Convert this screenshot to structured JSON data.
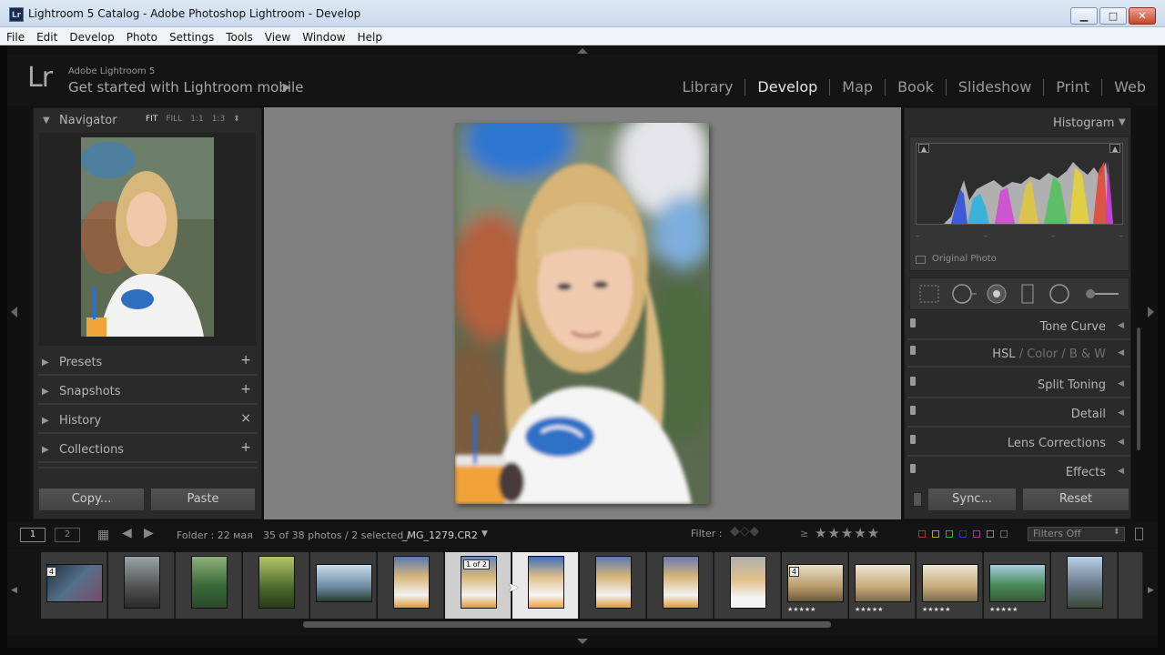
{
  "window": {
    "title": "Lightroom 5 Catalog - Adobe Photoshop Lightroom - Develop",
    "app_icon": "Lr",
    "controls": [
      "minimize-icon",
      "maximize-icon",
      "close-icon"
    ]
  },
  "menu": [
    "File",
    "Edit",
    "Develop",
    "Photo",
    "Settings",
    "Tools",
    "View",
    "Window",
    "Help"
  ],
  "identity": {
    "logo": "Lr",
    "product": "Adobe Lightroom 5",
    "mobile_prompt": "Get started with Lightroom mobile",
    "play_icon": "▶"
  },
  "modules": [
    "Library",
    "Develop",
    "Map",
    "Book",
    "Slideshow",
    "Print",
    "Web"
  ],
  "active_module": "Develop",
  "left": {
    "navigator": {
      "title": "Navigator",
      "zoom": [
        "FIT",
        "FILL",
        "1:1",
        "1:3"
      ],
      "zoom_active": "FIT"
    },
    "panels": [
      {
        "label": "Presets",
        "action": "+"
      },
      {
        "label": "Snapshots",
        "action": "+"
      },
      {
        "label": "History",
        "action": "×"
      },
      {
        "label": "Collections",
        "action": "+"
      }
    ],
    "copy_label": "Copy...",
    "paste_label": "Paste"
  },
  "right": {
    "histogram_title": "Histogram",
    "original_photo": "Original Photo",
    "tools": [
      "crop-overlay-icon",
      "spot-removal-icon",
      "red-eye-icon",
      "graduated-filter-icon",
      "radial-filter-icon",
      "adjustment-brush-icon"
    ],
    "panels": {
      "tone_curve": "Tone Curve",
      "hsl": "HSL",
      "color": "Color",
      "bw": "B & W",
      "split_toning": "Split Toning",
      "detail": "Detail",
      "lens": "Lens Corrections",
      "effects": "Effects"
    },
    "sync_label": "Sync...",
    "reset_label": "Reset"
  },
  "toolbar": {
    "view1": "1",
    "view2": "2",
    "folder": "Folder : 22 мая",
    "count": "35 of 38 photos / 2 selected /",
    "filename": "_MG_1279.CR2",
    "filter_label": "Filter :",
    "rating_op": "≥",
    "stars": "★★★★★",
    "filters_off": "Filters Off"
  },
  "filmstrip": {
    "badges": {
      "stack4": "4",
      "oneof2": "1 of 2"
    },
    "five_stars": "★★★★★"
  }
}
